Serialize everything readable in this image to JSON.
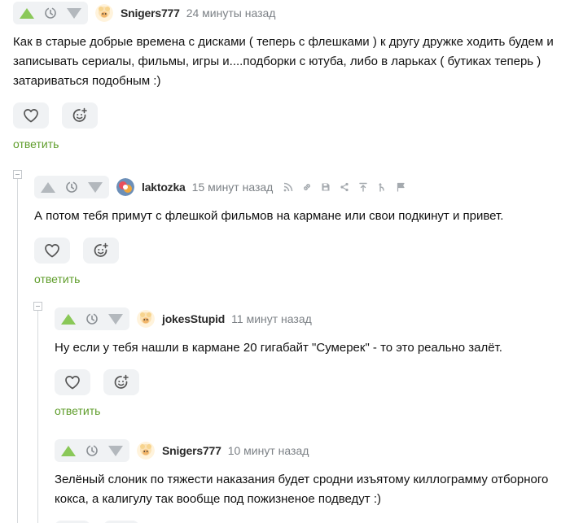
{
  "colors": {
    "accent_green": "#8ac858",
    "reply_green": "#5f9d2b",
    "muted": "#7c8186"
  },
  "comments": [
    {
      "author": "Snigers777",
      "time": "24 минуты назад",
      "avatar_icon": "sheep-avatar-icon",
      "upvoted": true,
      "text": "Как в старые добрые времена с дисками ( теперь с флешками ) к другу дружке ходить будем и записывать сериалы, фильмы, игры и....подборки с ютуба, либо в ларьках ( бутиках теперь ) затариваться подобным :)",
      "reply": "ответить"
    },
    {
      "author": "laktozka",
      "time": "15 минут назад",
      "avatar_icon": "colorful-avatar-icon",
      "upvoted": false,
      "text": "А потом тебя примут с флешкой фильмов на кармане или свои подкинут и привет.",
      "reply": "ответить",
      "tools": [
        "rss-icon",
        "link-icon",
        "save-icon",
        "share-icon",
        "arrow-up-icon",
        "branch-icon",
        "flag-icon"
      ]
    },
    {
      "author": "jokesStupid",
      "time": "11 минут назад",
      "avatar_icon": "sheep-avatar-icon",
      "upvoted": true,
      "text": "Ну если у тебя нашли в кармане 20 гигабайт \"Сумерек\" - то это реально залёт.",
      "reply": "ответить"
    },
    {
      "author": "Snigers777",
      "time": "10 минут назад",
      "avatar_icon": "sheep-avatar-icon",
      "upvoted": true,
      "text": "Зелёный слоник по тяжести наказания будет сродни изъятому киллограмму отборного кокса, а калигулу так вообще под пожизненое подведут :)",
      "reply": ""
    }
  ]
}
